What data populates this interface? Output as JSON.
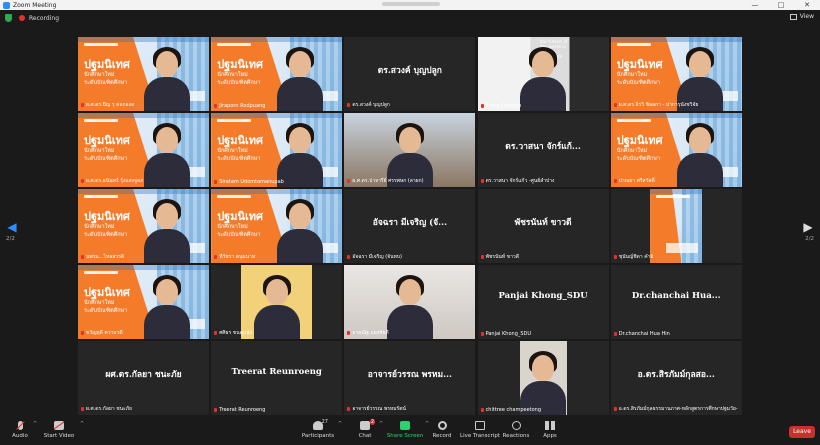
{
  "window": {
    "title": "Zoom Meeting",
    "minimize": "—",
    "maximize": "□",
    "close": "✕"
  },
  "status": {
    "recording": "Recording",
    "view": "View"
  },
  "nav": {
    "page_left": "2/2",
    "page_right": "2/2"
  },
  "slide_text": {
    "title": "ปฐมนิเทศ",
    "line1": "นักศึกษาใหม่",
    "line2": "ระดับบัณฑิตศึกษา"
  },
  "tiles": [
    {
      "type": "slide",
      "name": "ผ.ศ.ดร.ปิญ รุ คลกองส",
      "muted": true,
      "active": true
    },
    {
      "type": "slide",
      "name": "Jiraporn Rodpuang",
      "muted": true
    },
    {
      "type": "text",
      "big": "ดร.สวงค์ บุญปลูก",
      "name": "ดร.สวงค์ บุญปลูก",
      "muted": true
    },
    {
      "type": "photo-room",
      "name": "Trang Campus",
      "muted": true,
      "overlay": "the future of the world is in my classroom today"
    },
    {
      "type": "slide",
      "name": "ผ.ศ.ดร.จิรวิ ชิลลกา - ปาการุนังชวิจัย",
      "muted": true
    },
    {
      "type": "slide",
      "name": "ผ.ศ.ดร.ธนินทร์ รุ้งแสงจูลภ",
      "muted": true
    },
    {
      "type": "slide",
      "name": "Siratam Udomtamanupab",
      "muted": true
    },
    {
      "type": "photo-office",
      "name": "ผ.ศ.ดร.ปาจารีย์ ศรรพษก (ลาผก)",
      "muted": true
    },
    {
      "type": "text",
      "big": "ดร.วาสนา จักร์แก้...",
      "name": "ดร.วาสนา จักร์แก้ว -ศูนย์ลำปาง",
      "muted": true
    },
    {
      "type": "slide",
      "name": "ปาณยา ศรีสวัสดิ์",
      "muted": true
    },
    {
      "type": "slide",
      "name": "นพรม...ไหลสวรดิ",
      "muted": true
    },
    {
      "type": "slide",
      "name": "ทีวัชรา ตนุมนาท",
      "muted": true
    },
    {
      "type": "text",
      "big": "อัจฉรา มีเจริญ (จั...",
      "name": "อัจฉรา มีเจริญ (จันทบ)",
      "muted": true
    },
    {
      "type": "text",
      "big": "พัชรนันท์ ขาวดี",
      "name": "พัชรนันท์ ขาวดี",
      "muted": true
    },
    {
      "type": "slide-narrow",
      "name": "ชุนันญ์ชิดา คำอิ",
      "muted": true
    },
    {
      "type": "slide",
      "name": "ขวัญฤดี ความวดี",
      "muted": true
    },
    {
      "type": "photo-yellow",
      "name": "ศศิธร ขนดูแฉ่ง",
      "muted": true
    },
    {
      "type": "photo-wall",
      "name": "อาคณิฐ แผงซัยดี",
      "muted": true
    },
    {
      "type": "text",
      "big": "Panjai Khong_SDU",
      "name": "Panjai Khong_SDU",
      "muted": true
    },
    {
      "type": "text",
      "big": "Dr.chanchai Hua...",
      "name": "Dr.chanchai Hua Hin",
      "muted": true
    },
    {
      "type": "text",
      "big": "ผศ.ดร.กัลยา ชนะภัย",
      "name": "ผ.ศ.ดร.กัลยา ชนะภัย",
      "muted": true
    },
    {
      "type": "text",
      "big": "Treerat Reunroeng",
      "name": "Treerat Reunroeng",
      "muted": true
    },
    {
      "type": "text",
      "big": "อาจารย์วรรณ พรหม...",
      "name": "อาจารย์วรรณ พรหมรัตน์",
      "muted": true
    },
    {
      "type": "photo-portrait",
      "name": "chittree champeetong",
      "muted": true
    },
    {
      "type": "text",
      "big": "อ.ดร.สิรภัมม์กุลสอ...",
      "name": "อ.ดร.สิรภัมม์กุลธรรมานภาศ-หลักสูตรการศึกษาปฐมวัย-ม...",
      "muted": true
    }
  ],
  "toolbar": {
    "audio": "Audio",
    "video": "Start Video",
    "participants": "Participants",
    "participants_count": "27",
    "chat": "Chat",
    "chat_badge": "2",
    "share": "Share Screen",
    "record": "Record",
    "transcript": "Live Transcript",
    "reactions": "Reactions",
    "apps": "Apps",
    "leave": "Leave"
  },
  "colors": {
    "accent": "#2d8cff",
    "slide_orange": "#f47b2a",
    "share_green": "#2fd06d",
    "leave_red": "#c9302c",
    "active_border": "#e8d43a"
  }
}
